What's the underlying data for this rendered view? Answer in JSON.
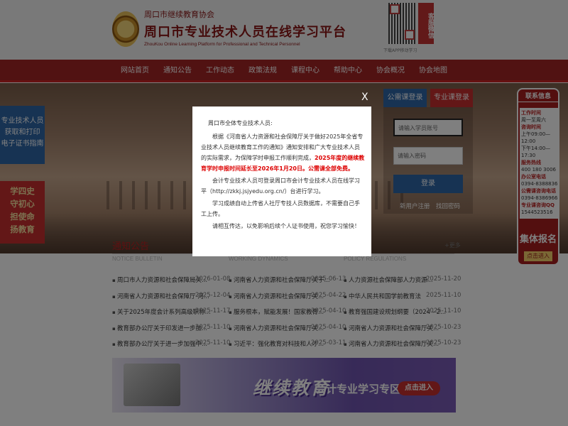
{
  "header": {
    "association": "周口市继续教育协会",
    "title": "周口市专业技术人员在线学习平台",
    "title_en": "ZhouKou Online Learning Platform for Professional and Technical Personnel",
    "qr_caption": "下载APP移动学习",
    "service_label": "客服微信"
  },
  "nav": [
    "网站首页",
    "通知公告",
    "工作动态",
    "政策法规",
    "课程中心",
    "帮助中心",
    "协会概况",
    "协会地图"
  ],
  "side": {
    "blue_lines": [
      "专业技术人员",
      "获取和打印",
      "电子证书指南"
    ],
    "red_lines": [
      "学四史",
      "守初心",
      "担使命",
      "扬教育"
    ]
  },
  "login": {
    "tab_public": "公需课登录",
    "tab_pro": "专业课登录",
    "user_placeholder": "请输入学员账号",
    "pass_placeholder": "请输入密码",
    "login_btn": "登录",
    "register": "新用户注册",
    "forgot": "找回密码"
  },
  "contact": {
    "title": "联系信息",
    "lines": [
      {
        "text": "工作时间",
        "em": true
      },
      {
        "text": "周一至周六",
        "em": false
      },
      {
        "text": "咨询时间",
        "em": true
      },
      {
        "text": "上午09:00—12:00",
        "em": false
      },
      {
        "text": "下午14:00—17:30",
        "em": false
      },
      {
        "text": "服务热线",
        "em": true
      },
      {
        "text": "400 180 3006",
        "em": false
      },
      {
        "text": "办公室电话",
        "em": true
      },
      {
        "text": "0394-8388836",
        "em": false
      },
      {
        "text": "公需课咨询电话",
        "em": true
      },
      {
        "text": "0394-8386966",
        "em": false
      },
      {
        "text": "专业课咨询QQ",
        "em": true
      },
      {
        "text": "1544523516",
        "em": false
      }
    ],
    "join_title": "集体报名",
    "join_btn": "点击进入"
  },
  "news": {
    "sections": [
      {
        "title": "通知公告",
        "sub": "NOTICE BULLETIN"
      },
      {
        "title": "",
        "sub": "WORKING DYNAMICS"
      },
      {
        "title": "",
        "sub": "POLICY REGULATIONS"
      }
    ],
    "more": "+更多",
    "col1": [
      {
        "t": "周口市人力资源和社会保障局关...",
        "d": "2026-01-08"
      },
      {
        "t": "河南省人力资源和社会保障厅 河...",
        "d": "2025-12-04"
      },
      {
        "t": "关于2025年度会计系列高级职称...",
        "d": "2025-11-17"
      },
      {
        "t": "教育部办公厅关于印发进一步加...",
        "d": "2025-11-10"
      },
      {
        "t": "教育部办公厅关于进一步加强中...",
        "d": "2025-11-10"
      }
    ],
    "col2": [
      {
        "t": "河南省人力资源和社会保障厅关于...",
        "d": "2025-06-13"
      },
      {
        "t": "河南省人力资源和社会保障厅关...",
        "d": "2025-04-22"
      },
      {
        "t": "服务根本，赋能发展！国家教育...",
        "d": "2025-04-10"
      },
      {
        "t": "河南省人力资源和社会保障厅关...",
        "d": "2025-04-10"
      },
      {
        "t": "习近平：强化教育对科技和人才...",
        "d": "2025-03-11"
      }
    ],
    "col3": [
      {
        "t": "人力资源社会保障部人力资源...",
        "d": "2025-11-20"
      },
      {
        "t": "中华人民共和国学前教育法",
        "d": "2025-11-10"
      },
      {
        "t": "教育强国建设规划纲要（2024 - 2...",
        "d": "2025-11-10"
      },
      {
        "t": "河南省人力资源和社会保障厅关...",
        "d": "2025-10-23"
      },
      {
        "t": "河南省人力资源和社会保障厅关...",
        "d": "2025-10-23"
      }
    ]
  },
  "bottom_banner": {
    "big": "继续教育",
    "sub": "会计专业学习专区",
    "btn": "点击进入"
  },
  "modal": {
    "close": "X",
    "greeting": "周口市全体专业技术人员:",
    "p1": "根据《河南省人力资源和社会保障厅关于做好2025年全省专业技术人员继续教育工作的通知》通知安排和广大专业技术人员的实际需求，为保障学时申报工作顺利完成，",
    "p1_red": "2025年度的继续教育学时申报时间延长至2026年1月20日。公需课全部免费。",
    "p2": "会计专业技术人员可登录周口市会计专业技术人员在线学习平（http://zkkj.jsjyedu.org.cn/）台进行学习。",
    "p3": "学习成绩自动上传省人社厅专技人员数据库，不需要自己手工上传。",
    "p4": "请相互传达，以免影响后续个人证书使用，祝您学习愉快！"
  }
}
